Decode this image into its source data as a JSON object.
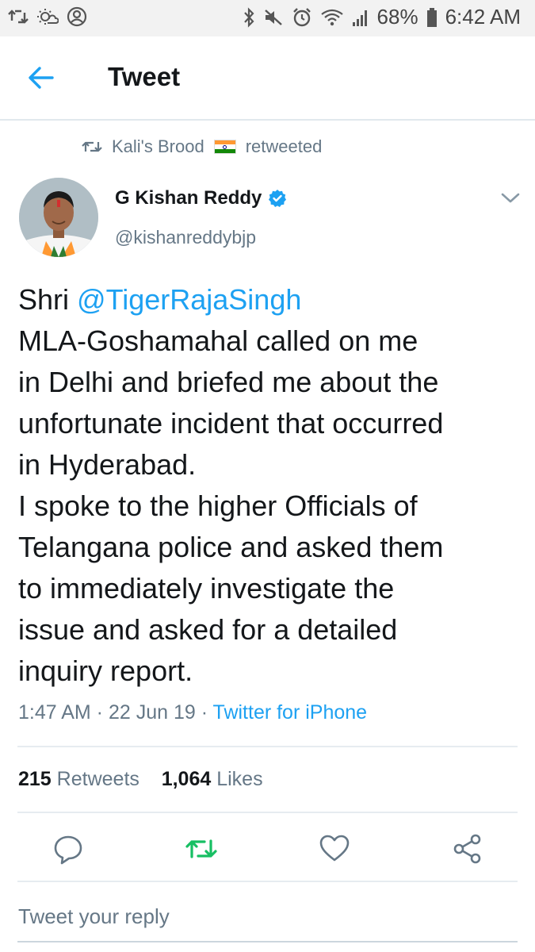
{
  "status_bar": {
    "battery": "68%",
    "time": "6:42 AM"
  },
  "header": {
    "title": "Tweet"
  },
  "retweet_context": {
    "retweeter": "Kali's Brood",
    "suffix": "retweeted"
  },
  "author": {
    "name": "G Kishan Reddy",
    "handle": "@kishanreddybjp",
    "verified": true
  },
  "tweet": {
    "line1_prefix": "Shri ",
    "mention": "@TigerRajaSingh",
    "lines": [
      "MLA-Goshamahal called on me",
      "in Delhi and briefed me about the",
      "unfortunate incident that occurred",
      "in Hyderabad.",
      "I spoke to the higher Officials of",
      "Telangana police and asked them",
      "to immediately investigate the",
      "issue and asked for a detailed",
      "inquiry report."
    ],
    "time": "1:47 AM",
    "date": "22 Jun 19",
    "separator": " · ",
    "source": "Twitter for iPhone"
  },
  "stats": {
    "retweets_count": "215",
    "retweets_label": "Retweets",
    "likes_count": "1,064",
    "likes_label": "Likes"
  },
  "reply": {
    "placeholder": "Tweet your reply"
  },
  "colors": {
    "accent": "#1da1f2",
    "retweet_green": "#17bf63",
    "secondary_text": "#657786"
  }
}
